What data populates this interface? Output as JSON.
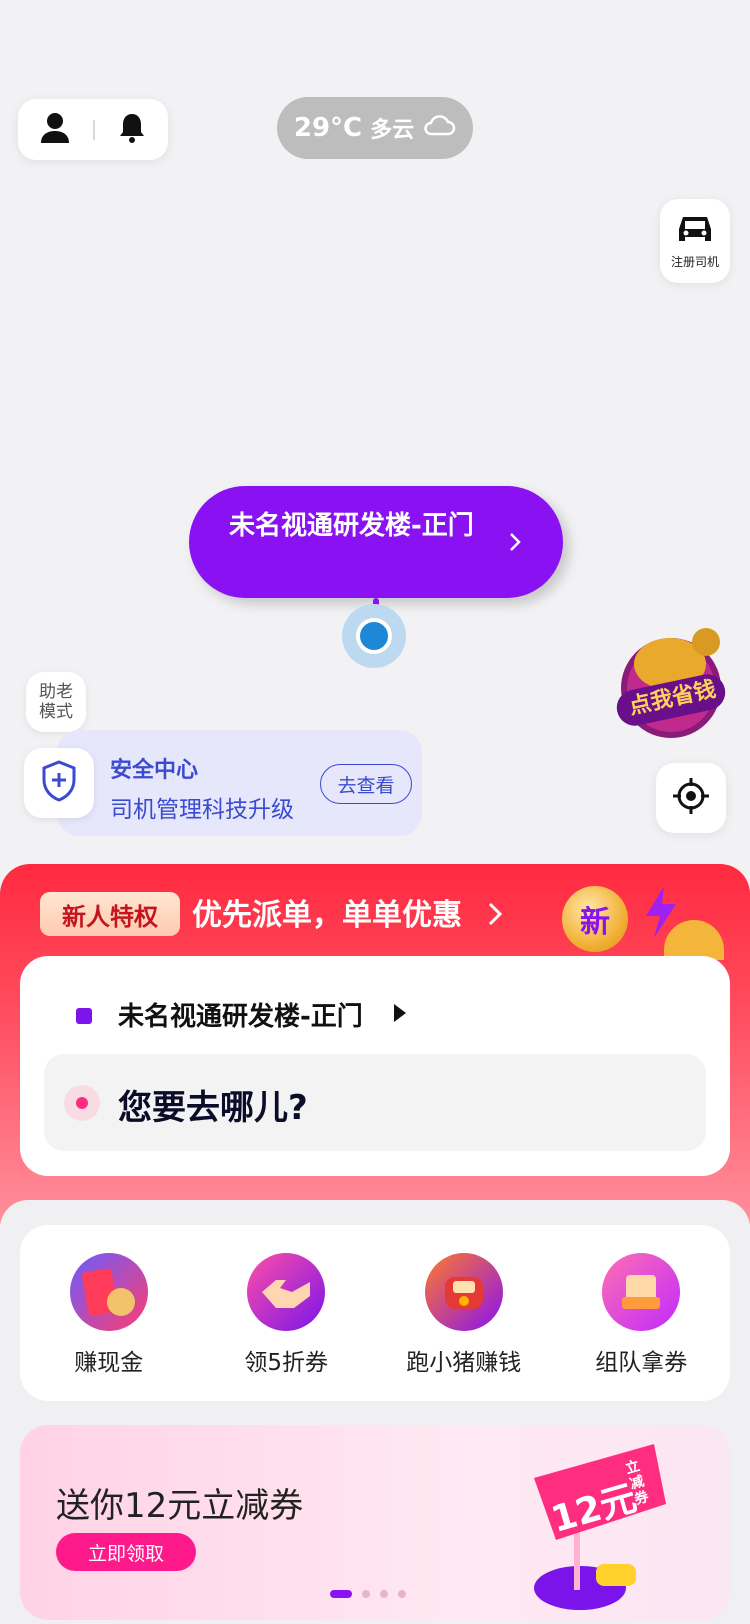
{
  "weather": {
    "temp": "29°C",
    "condition": "多云",
    "icon": "cloud-icon"
  },
  "top_buttons": {
    "profile_icon": "person-icon",
    "notify_icon": "bell-icon"
  },
  "register_driver": {
    "label": "注册司机",
    "icon": "car-icon"
  },
  "map_pin": {
    "label": "未名视通研发楼-正门",
    "icon": "chevron-right-icon"
  },
  "elder_mode": {
    "line1": "助老",
    "line2": "模式"
  },
  "safety": {
    "title": "安全中心",
    "subtitle": "司机管理科技升级",
    "button": "去查看",
    "icon": "shield-plus-icon"
  },
  "promo_coin": {
    "text": "点我省钱"
  },
  "banner": {
    "tag": "新人特权",
    "text": "优先派单，单单优惠",
    "badge": "新"
  },
  "trip": {
    "from": "未名视通研发楼-正门",
    "to_placeholder": "您要去哪儿?"
  },
  "services": [
    {
      "label": "赚现金",
      "icon": "cash-coupon-icon"
    },
    {
      "label": "领5折券",
      "icon": "handshake-icon"
    },
    {
      "label": "跑小猪赚钱",
      "icon": "pig-wallet-icon"
    },
    {
      "label": "组队拿券",
      "icon": "team-coupon-icon"
    }
  ],
  "coupon_promo": {
    "title": "送你12元立减券",
    "button": "立即领取",
    "flag_amount": "12元",
    "flag_text": "立减券"
  },
  "colors": {
    "brand_purple": "#8a11f1",
    "accent_red": "#ff2a40",
    "accent_pink": "#ff1a8c",
    "safety_blue": "#3b4bcf"
  }
}
